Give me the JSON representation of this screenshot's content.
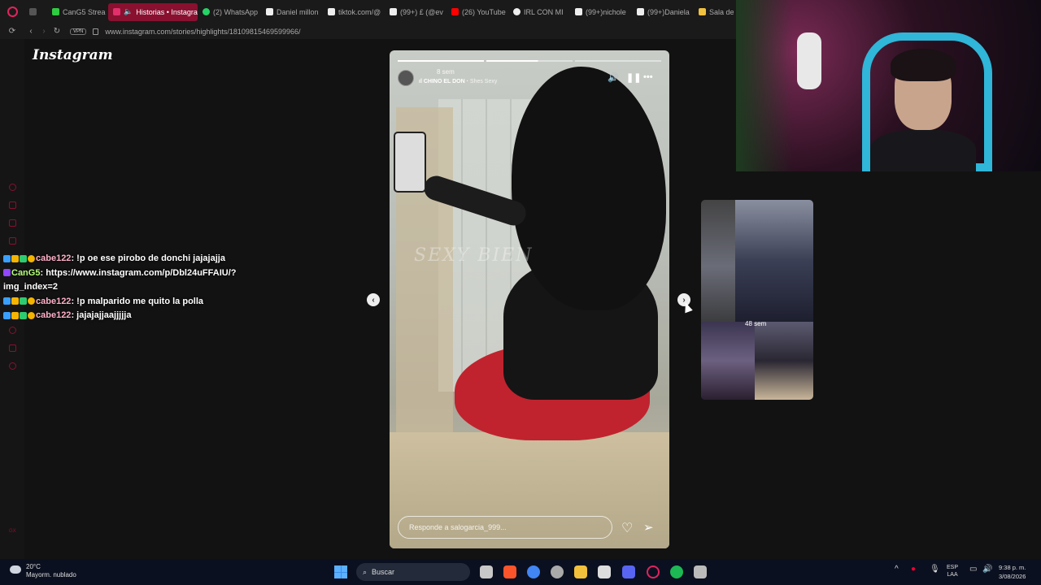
{
  "browser": {
    "tabs": [
      {
        "label": "CanG5 Strea",
        "color": "#2ecc40",
        "active": false
      },
      {
        "label": "Historias • Instagra",
        "color": "#e1306c",
        "active": true
      },
      {
        "label": "(2) WhatsApp",
        "color": "#25d366",
        "active": false
      },
      {
        "label": "Daniel millon",
        "color": "#ffffff",
        "active": false
      },
      {
        "label": "tiktok.com/@",
        "color": "#ffffff",
        "active": false
      },
      {
        "label": "(99+) £ (@ev",
        "color": "#ffffff",
        "active": false
      },
      {
        "label": "(26) YouTube",
        "color": "#ff0000",
        "active": false
      },
      {
        "label": "IRL CON MI",
        "color": "#ffffff",
        "active": false
      },
      {
        "label": "(99+)nichole",
        "color": "#ffffff",
        "active": false
      },
      {
        "label": "(99+)Daniela",
        "color": "#ffffff",
        "active": false
      },
      {
        "label": "Sala de",
        "color": "#f0c040",
        "active": false
      }
    ],
    "url": "www.instagram.com/stories/highlights/18109815469599966/",
    "vpn_label": "VPN"
  },
  "page": {
    "logo": "Instagram"
  },
  "chat": [
    {
      "user": "cabe122",
      "message": "!p oe ese pirobo de donchi jajajajja",
      "user_class": "user1"
    },
    {
      "user": "CanG5",
      "message": "https://www.instagram.com/p/Dbl24uFFAIU/?img_index=2",
      "user_class": "user2"
    },
    {
      "user": "cabe122",
      "message": "!p malparido me quito la polla",
      "user_class": "user1"
    },
    {
      "user": "cabe122",
      "message": "jajajajjaajjjjja",
      "user_class": "user1"
    }
  ],
  "story": {
    "time_ago": "8 sem",
    "song_artist": "CHINO EL DON",
    "song_title": "Shes Sexy",
    "watermark": "SEXY BIEN",
    "reply_placeholder": "Responde a salogarcia_999...",
    "progress_segments": 3,
    "progress_current": 2
  },
  "next_preview": {
    "time_ago": "48 sem"
  },
  "taskbar": {
    "weather_temp": "20°C",
    "weather_desc": "Mayorm. nublado",
    "search_label": "Buscar",
    "lang_top": "ESP",
    "lang_bottom": "LAA",
    "time": "9:38 p. m.",
    "date": "3/08/2026"
  }
}
